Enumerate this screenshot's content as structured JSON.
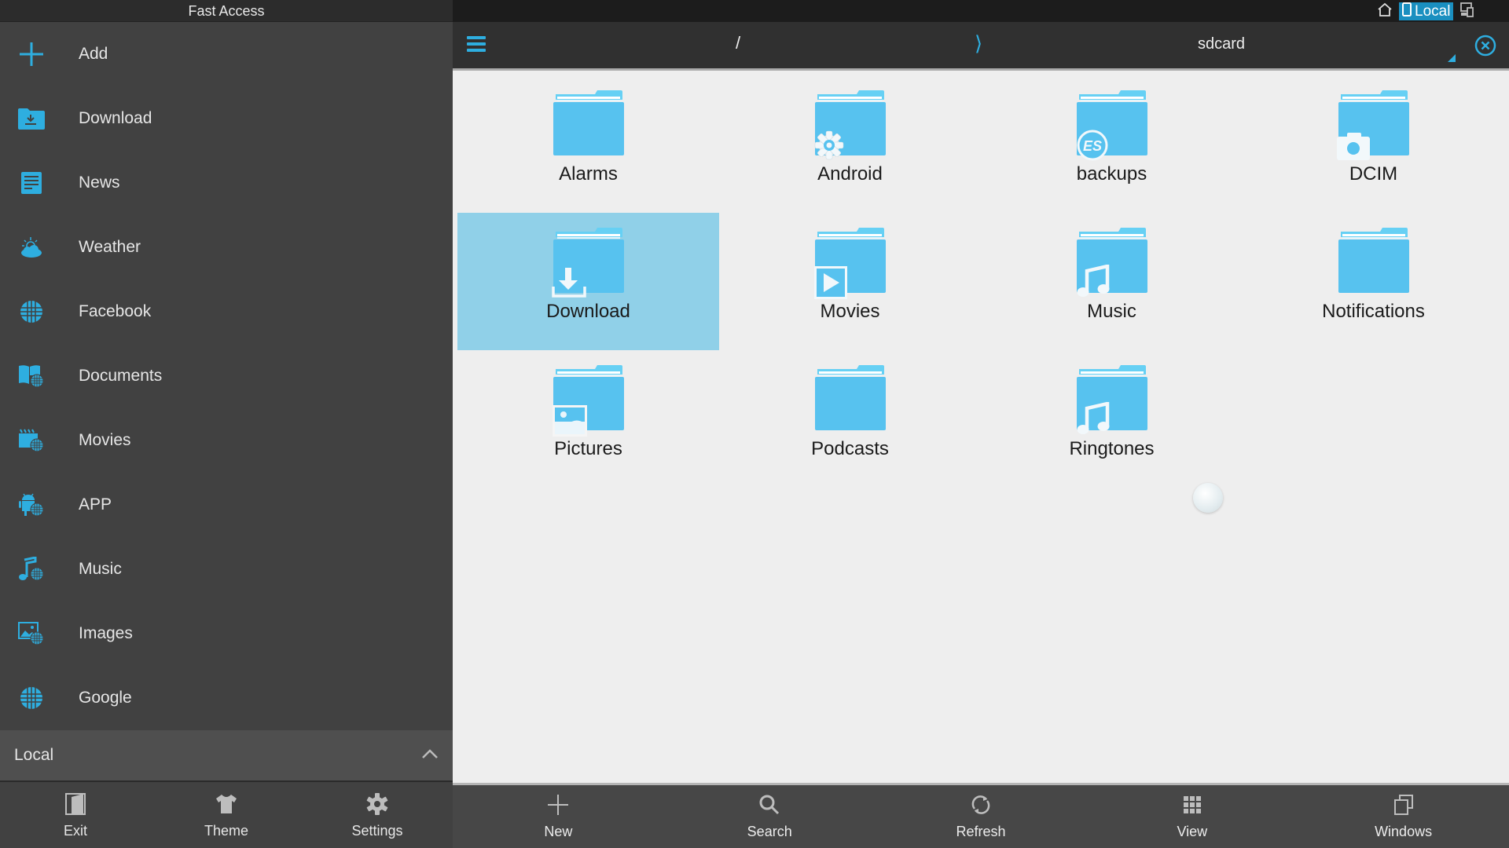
{
  "sidebar": {
    "title": "Fast Access",
    "items": [
      {
        "label": "Add",
        "icon": "plus-icon"
      },
      {
        "label": "Download",
        "icon": "download-folder-icon"
      },
      {
        "label": "News",
        "icon": "news-icon"
      },
      {
        "label": "Weather",
        "icon": "weather-icon"
      },
      {
        "label": "Facebook",
        "icon": "globe-icon"
      },
      {
        "label": "Documents",
        "icon": "documents-web-icon"
      },
      {
        "label": "Movies",
        "icon": "movies-web-icon"
      },
      {
        "label": "APP",
        "icon": "app-web-icon"
      },
      {
        "label": "Music",
        "icon": "music-web-icon"
      },
      {
        "label": "Images",
        "icon": "images-web-icon"
      },
      {
        "label": "Google",
        "icon": "globe-icon"
      }
    ],
    "section": {
      "label": "Local",
      "expanded": true
    },
    "bottom": [
      {
        "label": "Exit",
        "icon": "exit-icon"
      },
      {
        "label": "Theme",
        "icon": "shirt-icon"
      },
      {
        "label": "Settings",
        "icon": "gear-icon"
      }
    ]
  },
  "tabs": {
    "home_icon": "home-icon",
    "active_label": "Local",
    "device_icon": "devices-icon"
  },
  "header": {
    "root": "/",
    "separator": "⟩",
    "current": "sdcard"
  },
  "folders": [
    {
      "name": "Alarms",
      "badge": "none",
      "selected": false
    },
    {
      "name": "Android",
      "badge": "gear",
      "selected": false
    },
    {
      "name": "backups",
      "badge": "es",
      "selected": false
    },
    {
      "name": "DCIM",
      "badge": "camera",
      "selected": false
    },
    {
      "name": "Download",
      "badge": "download",
      "selected": true
    },
    {
      "name": "Movies",
      "badge": "play",
      "selected": false
    },
    {
      "name": "Music",
      "badge": "music",
      "selected": false
    },
    {
      "name": "Notifications",
      "badge": "none",
      "selected": false
    },
    {
      "name": "Pictures",
      "badge": "picture",
      "selected": false
    },
    {
      "name": "Podcasts",
      "badge": "none",
      "selected": false
    },
    {
      "name": "Ringtones",
      "badge": "music",
      "selected": false
    }
  ],
  "toolbar": [
    {
      "label": "New",
      "icon": "plus-icon"
    },
    {
      "label": "Search",
      "icon": "search-icon"
    },
    {
      "label": "Refresh",
      "icon": "refresh-icon"
    },
    {
      "label": "View",
      "icon": "grid-view-icon"
    },
    {
      "label": "Windows",
      "icon": "windows-icon"
    }
  ],
  "colors": {
    "accent": "#2eaee0",
    "folder": "#57c2ef",
    "selection": "#90d0e8",
    "sidebar_bg": "#414141"
  }
}
